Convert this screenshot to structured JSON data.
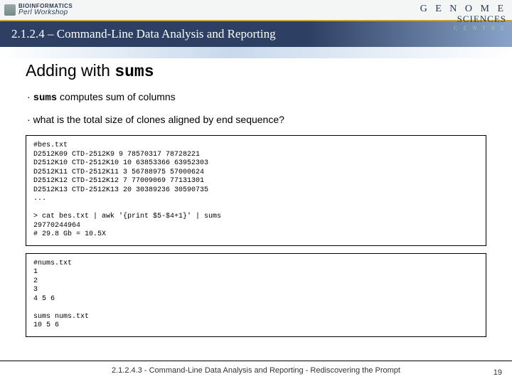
{
  "brand_left": {
    "line1": "BIOINFORMATICS",
    "line2": "Perl Workshop"
  },
  "brand_right": {
    "g1": "G E N O M E",
    "g2": "SCIENCES",
    "g3": "C E N T R E"
  },
  "section_title": "2.1.2.4 – Command-Line Data Analysis and Reporting",
  "heading_prefix": "Adding with ",
  "heading_code": "sums",
  "bullet1_code": "sums",
  "bullet1_rest": " computes sum of columns",
  "bullet2": "what is the total size of clones aligned by end sequence?",
  "code1": "#bes.txt\nD2512K09 CTD-2512K9 9 78570317 78728221\nD2512K10 CTD-2512K10 10 63853366 63952303\nD2512K11 CTD-2512K11 3 56788975 57000624\nD2512K12 CTD-2512K12 7 77009069 77131301\nD2512K13 CTD-2512K13 20 30389236 30590735\n...\n\n> cat bes.txt | awk '{print $5-$4+1}' | sums\n29770244964\n# 29.8 Gb = 10.5X",
  "code2": "#nums.txt\n1\n2\n3\n4 5 6\n\nsums nums.txt\n10 5 6",
  "footer": "2.1.2.4.3 - Command-Line Data Analysis and Reporting - Rediscovering the Prompt",
  "page": "19"
}
